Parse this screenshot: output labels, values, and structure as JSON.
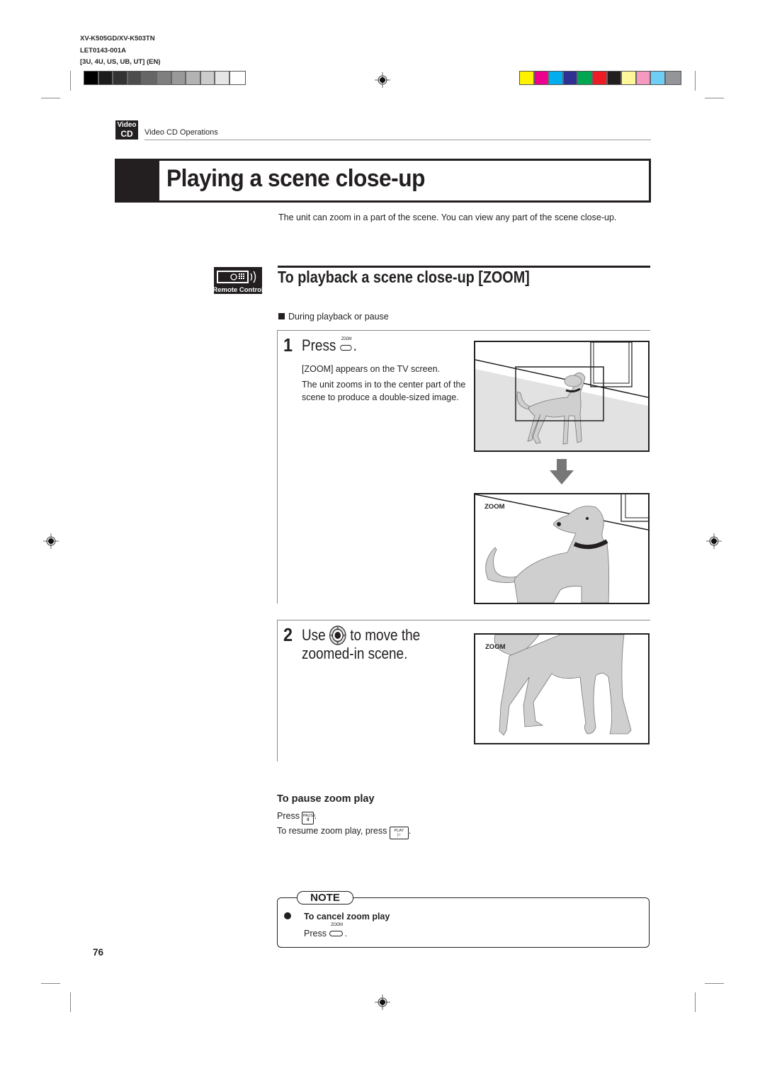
{
  "print_meta": {
    "model": "XV-K505GD/XV-K503TN",
    "doc_code": "LET0143-001A",
    "regions": "[3U, 4U, US, UB, UT]   (EN)"
  },
  "gray_swatches": [
    "#000000",
    "#1c1c1c",
    "#333333",
    "#4d4d4d",
    "#666666",
    "#7f7f7f",
    "#999999",
    "#b3b3b3",
    "#cccccc",
    "#e6e6e6",
    "#ffffff"
  ],
  "color_swatches": [
    "#fff200",
    "#ec008c",
    "#00aeef",
    "#2e3192",
    "#00a651",
    "#ed1c24",
    "#231f20",
    "#fff799",
    "#f49ac1",
    "#6dcff6",
    "#939598"
  ],
  "section": {
    "badge_line1": "Video",
    "badge_line2": "CD",
    "label": "Video CD Operations"
  },
  "page_title": "Playing a scene close-up",
  "intro": "The unit can zoom in a part of the scene.  You can view any part of the scene close-up.",
  "remote_icon_label": "Remote Control",
  "subsection_title": "To playback a scene close-up  [ZOOM]",
  "condition": "During playback or pause",
  "step1": {
    "number": "1",
    "press_label": "Press",
    "button_caption": "ZOOM",
    "line1": "[ZOOM] appears on the TV screen.",
    "line2": "The unit zooms in to the center part of the scene to produce a double-sized image."
  },
  "step2": {
    "number": "2",
    "use_label": "Use",
    "after_icon": "to move the",
    "line2": "zoomed-in scene."
  },
  "screen_labels": {
    "zoom_osd_1": "ZOOM",
    "zoom_osd_2": "ZOOM"
  },
  "pause": {
    "heading": "To pause zoom play",
    "press_label": "Press",
    "pause_key_caption": "PAUSE",
    "pause_key_symbol": "II",
    "resume_label": "To resume zoom play, press",
    "play_key_caption": "PLAY",
    "play_key_symbol": "▷"
  },
  "note": {
    "tag": "NOTE",
    "heading": "To cancel zoom play",
    "press_label": "Press",
    "button_caption": "ZOOM"
  },
  "page_number": "76"
}
